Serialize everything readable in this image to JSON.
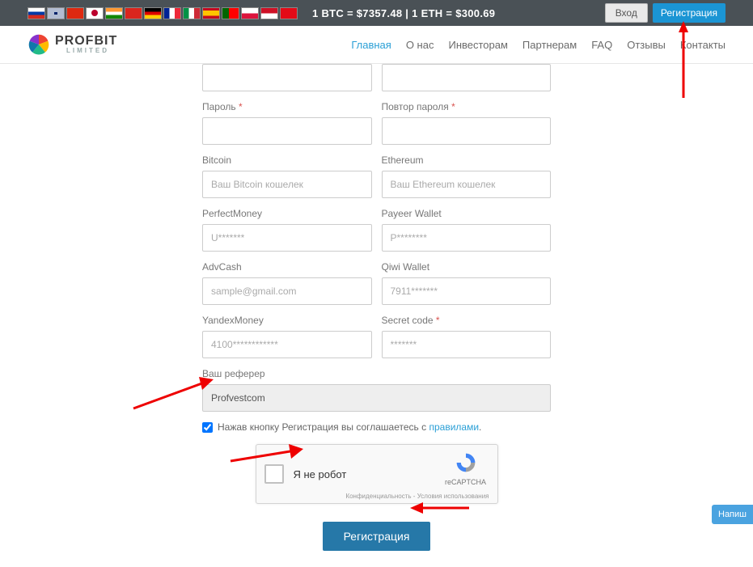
{
  "topbar": {
    "rates_text": "1 BTC = $7357.48    |    1 ETH = $300.69",
    "login": "Вход",
    "register": "Регистрация"
  },
  "logo": {
    "main": "PROFBIT",
    "sub": "LIMITED"
  },
  "nav": {
    "home": "Главная",
    "about": "О нас",
    "investors": "Инвесторам",
    "partners": "Партнерам",
    "faq": "FAQ",
    "reviews": "Отзывы",
    "contacts": "Контакты"
  },
  "form": {
    "password_label": "Пароль",
    "password_repeat_label": "Повтор пароля",
    "bitcoin_label": "Bitcoin",
    "bitcoin_ph": "Ваш Bitcoin кошелек",
    "eth_label": "Ethereum",
    "eth_ph": "Ваш Ethereum кошелек",
    "pm_label": "PerfectMoney",
    "pm_ph": "U*******",
    "payeer_label": "Payeer Wallet",
    "payeer_ph": "P********",
    "adv_label": "AdvCash",
    "adv_ph": "sample@gmail.com",
    "qiwi_label": "Qiwi Wallet",
    "qiwi_ph": "7911*******",
    "ym_label": "YandexMoney",
    "ym_ph": "4100************",
    "secret_label": "Secret code",
    "secret_ph": "*******",
    "referrer_label": "Ваш реферер",
    "referrer_value": "Profvestcom",
    "agree_text": "Нажав кнопку Регистрация вы соглашаетесь с ",
    "agree_link": "правилами",
    "agree_dot": ".",
    "captcha_label": "Я не робот",
    "captcha_brand": "reCAPTCHA",
    "captcha_links": "Конфиденциальность - Условия использования",
    "submit": "Регистрация"
  },
  "chat": "Напиш"
}
